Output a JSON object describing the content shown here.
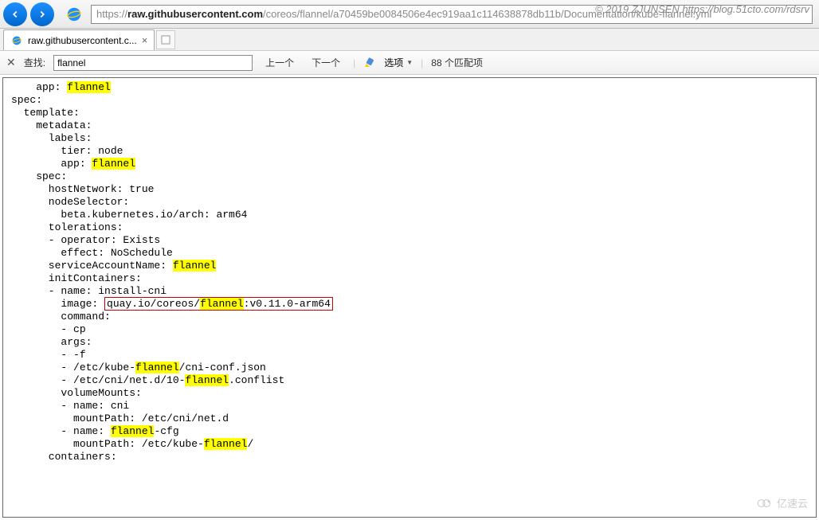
{
  "watermark_top": "© 2019 ZJUNSEN https://blog.51cto.com/rdsrv",
  "watermark_bottom": "亿速云",
  "url": {
    "protocol": "https://",
    "host": "raw.githubusercontent.com",
    "path": "/coreos/flannel/a70459be0084506e4ec919aa1c114638878db11b/Documentation/kube-flannel.yml"
  },
  "tab": {
    "title": "raw.githubusercontent.c..."
  },
  "find": {
    "label": "查找:",
    "value": "flannel",
    "prev": "上一个",
    "next": "下一个",
    "options": "选项",
    "matches": "88 个匹配项"
  },
  "yaml": {
    "search_term": "flannel",
    "lines": [
      {
        "indent": 4,
        "text": "app: [HL]"
      },
      {
        "indent": 0,
        "text": "spec:"
      },
      {
        "indent": 2,
        "text": "template:"
      },
      {
        "indent": 4,
        "text": "metadata:"
      },
      {
        "indent": 6,
        "text": "labels:"
      },
      {
        "indent": 8,
        "text": "tier: node"
      },
      {
        "indent": 8,
        "text": "app: [HL]"
      },
      {
        "indent": 4,
        "text": "spec:"
      },
      {
        "indent": 6,
        "text": "hostNetwork: true"
      },
      {
        "indent": 6,
        "text": "nodeSelector:"
      },
      {
        "indent": 8,
        "text": "beta.kubernetes.io/arch: arm64"
      },
      {
        "indent": 6,
        "text": "tolerations:"
      },
      {
        "indent": 6,
        "text": "- operator: Exists"
      },
      {
        "indent": 8,
        "text": "effect: NoSchedule"
      },
      {
        "indent": 6,
        "text": "serviceAccountName: [HL]"
      },
      {
        "indent": 6,
        "text": "initContainers:"
      },
      {
        "indent": 6,
        "text": "- name: install-cni"
      },
      {
        "indent": 8,
        "text": "image: ",
        "redbox": "quay.io/coreos/[HL]:v0.11.0-arm64"
      },
      {
        "indent": 8,
        "text": "command:"
      },
      {
        "indent": 8,
        "text": "- cp"
      },
      {
        "indent": 8,
        "text": "args:"
      },
      {
        "indent": 8,
        "text": "- -f"
      },
      {
        "indent": 8,
        "text": "- /etc/kube-[HL]/cni-conf.json"
      },
      {
        "indent": 8,
        "text": "- /etc/cni/net.d/10-[HL].conflist"
      },
      {
        "indent": 8,
        "text": "volumeMounts:"
      },
      {
        "indent": 8,
        "text": "- name: cni"
      },
      {
        "indent": 10,
        "text": "mountPath: /etc/cni/net.d"
      },
      {
        "indent": 8,
        "text": "- name: [HL]-cfg"
      },
      {
        "indent": 10,
        "text": "mountPath: /etc/kube-[HL]/"
      },
      {
        "indent": 6,
        "text": "containers:"
      }
    ]
  }
}
